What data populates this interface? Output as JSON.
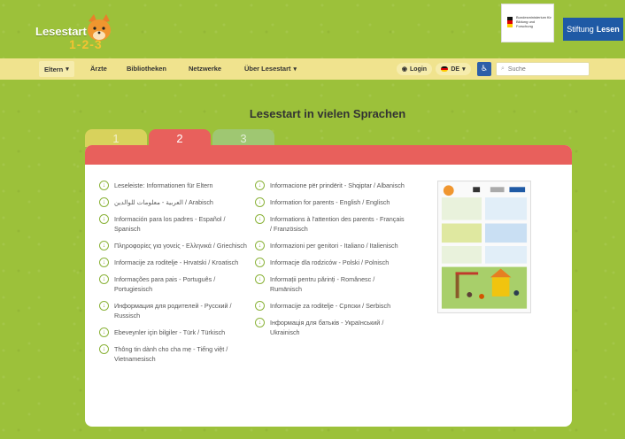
{
  "header": {
    "logo_text": "Lesestart",
    "logo_number": "1-2-3",
    "ministry_text": "Bundesministerium für Bildung und Forschung",
    "stiftung_part1": "Stiftung",
    "stiftung_part2": "Lesen"
  },
  "nav": {
    "items": [
      {
        "label": "Eltern",
        "has_dropdown": true
      },
      {
        "label": "Ärzte"
      },
      {
        "label": "Bibliotheken"
      },
      {
        "label": "Netzwerke"
      },
      {
        "label": "Über Lesestart",
        "has_dropdown": true
      }
    ],
    "login_label": "Login",
    "language_label": "DE",
    "search_placeholder": "Suche"
  },
  "main": {
    "title": "Lesestart in vielen Sprachen",
    "tabs": [
      "1",
      "2",
      "3"
    ],
    "active_tab": 1,
    "col1": [
      "Leseleiste: Informationen für Eltern",
      "العربية - معلومات للوالدين / Arabisch",
      "Información para los padres - Español / Spanisch",
      "Πληροφορίες για γονείς - Ελληνικά / Griechisch",
      "Informacije za roditelje - Hrvatski / Kroatisch",
      "Informações para pais - Português / Portugiesisch",
      "Информация для родителей - Русский / Russisch",
      "Ebeveynler için bilgiler - Türk / Türkisch",
      "Thông tin dành cho cha mẹ - Tiếng việt / Vietnamesisch"
    ],
    "col2": [
      "Informacione për prindërit - Shqiptar / Albanisch",
      "Information for parents - English / Englisch",
      "Informations à l'attention des parents - Français / Französisch",
      "Informazioni per genitori - Italiano / Italienisch",
      "Informacje dla rodziców - Polski / Polnisch",
      "Informații pentru părinți - Românesc / Rumänisch",
      "Informacije za roditelje - Српски / Serbisch",
      "Інформація для батьків - Український / Ukrainisch"
    ]
  },
  "colors": {
    "background": "#9cc13a",
    "navbar": "#f0e38e",
    "tab_active": "#e8605c",
    "tab1": "#d8d25c",
    "tab3": "#9fc772",
    "icon_green": "#8bb33a",
    "stiftung_blue": "#1f5aa5"
  }
}
